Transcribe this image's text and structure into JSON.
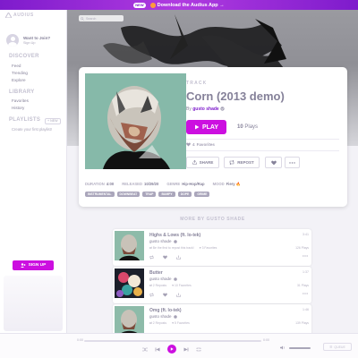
{
  "banner": {
    "badge": "NEW",
    "text": "Download the Audius App →"
  },
  "sidebar": {
    "logo": "AUDIUS",
    "profile": {
      "title": "Want to Join?",
      "subtitle": "Sign Up"
    },
    "discover": {
      "heading": "DISCOVER",
      "items": [
        "Feed",
        "Trending",
        "Explore"
      ]
    },
    "library": {
      "heading": "LIBRARY",
      "items": [
        "Favorites",
        "History"
      ]
    },
    "playlists": {
      "heading": "PLAYLISTS",
      "new_label": "NEW",
      "empty": "Create your first playlist!"
    },
    "signup_label": "SIGN UP"
  },
  "search": {
    "placeholder": "Search"
  },
  "track": {
    "label": "TRACK",
    "title": "Corn (2013 demo)",
    "by_prefix": "By",
    "artist": "gusto shade",
    "play_label": "PLAY",
    "plays_count": "10",
    "plays_label": "Plays",
    "favorites_count": "4",
    "favorites_label": "Favorites",
    "share_label": "SHARE",
    "repost_label": "REPOST",
    "meta": {
      "duration_label": "DURATION",
      "duration": "4:00",
      "released_label": "RELEASED",
      "released": "10/29/20",
      "genre_label": "GENRE",
      "genre": "Hip-Hop/Rap",
      "mood_label": "MOOD",
      "mood": "Fiery"
    },
    "tags": [
      "INSTRUMENTAL",
      "DOWNBEAT",
      "TRAP",
      "BUMPY",
      "DOPE",
      "GRIME"
    ]
  },
  "more_heading": "MORE BY GUSTO SHADE",
  "more_tracks": [
    {
      "title": "Highs & Lows (ft. lo-tek)",
      "artist": "gusto shade",
      "duration": "3:41",
      "plays": "126 Plays",
      "stat1": "Be the first to repost this track!",
      "stat2": "3 Favorites"
    },
    {
      "title": "Butter",
      "artist": "gusto shade",
      "duration": "1:37",
      "plays": "31 Plays",
      "stat1": "2 Reposts",
      "stat2": "10 Favorites"
    },
    {
      "title": "Omg (ft. lo-tek)",
      "artist": "gusto shade",
      "duration": "1:46",
      "plays": "139 Plays",
      "stat1": "2 Reposts",
      "stat2": "5 Favorites"
    }
  ],
  "player": {
    "elapsed": "0:00",
    "remaining": "0:00",
    "queue_label": "QUEUE"
  },
  "colors": {
    "accent": "#cc0fe0",
    "brand_purple": "#7e1bcc",
    "text_gray": "#858199"
  }
}
